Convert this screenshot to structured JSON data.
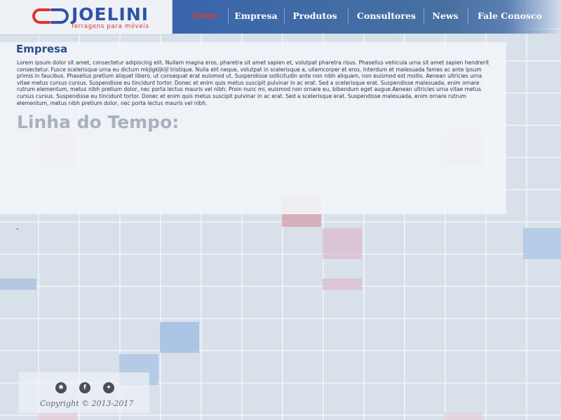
{
  "logo": {
    "name": "JOELINI",
    "tagline": "ferragens para móveis"
  },
  "nav": {
    "items": [
      {
        "label": "Home",
        "active": true
      },
      {
        "label": "Empresa",
        "active": false
      },
      {
        "label": "Produtos",
        "active": false
      },
      {
        "label": "Consultores",
        "active": false
      },
      {
        "label": "News",
        "active": false
      },
      {
        "label": "Fale Conosco",
        "active": false
      }
    ]
  },
  "main": {
    "section_title": "Empresa",
    "body_text": "Lorem ipsum dolor sit amet, consectetur adipiscing elit. Nullam magna eros, pharetra sit amet sapien et, volutpat pharetra risus. Phasellus vehicula urna sit amet sapien hendrerit consectetur. Fusce scelerisque urna eu dictum mkjlgkljkljl tristique. Nulla elit neque, volutpat in scelerisque a, ullamcorper et eros. Interdum et malesuada fames ac ante ipsum primis in faucibus. Phasellus pretium aliquet libero, ut consequat erat euismod ut. Suspendisse sollicitudin ante non nibh aliquam, non euismod est mollis. Aenean ultricies urna vitae metus cursus cursus. Suspendisse eu tincidunt tortor. Donec et enim quis metus suscipit pulvinar in ac erat. Sed a scelerisque erat. Suspendisse malesuada, enim ornare rutrum elementum, metus nibh pretium dolor, nec porta lectus mauris vel nibh. Proin nunc mi, euismod non ornare eu, bibendum eget augue.Aenean ultricies urna vitae metus cursus cursus. Suspendisse eu tincidunt tortor. Donec et enim quis metus suscipit pulvinar in ac erat. Sed a scelerisque erat. Suspendisse malesuada, enim ornare rutrum elementum, metus nibh pretium dolor, nec porta lectus mauris vel nibh.",
    "timeline_title": "Linha do Tempo:"
  },
  "footer": {
    "social": [
      {
        "icon": "pinterest-icon",
        "glyph": "✱"
      },
      {
        "icon": "facebook-icon",
        "glyph": "f"
      },
      {
        "icon": "twitter-icon",
        "glyph": "✦"
      }
    ],
    "copyright": "Copyright © 2013-2017"
  },
  "colors": {
    "brand_blue": "#2f54a5",
    "brand_red": "#e0332e",
    "nav_blue": "#3a65ac",
    "active_nav": "#e03a2a"
  }
}
